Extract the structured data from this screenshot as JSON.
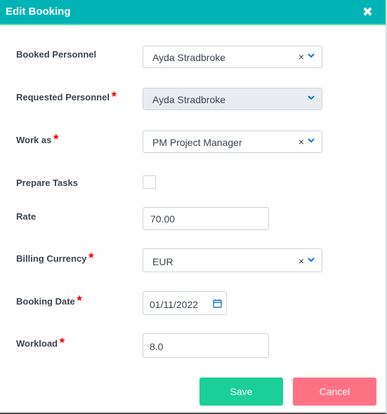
{
  "dialog": {
    "title": "Edit Booking",
    "close_icon": "close-icon"
  },
  "fields": {
    "booked_personnel": {
      "label": "Booked Personnel",
      "value": "Ayda Stradbroke",
      "required": false
    },
    "requested_personnel": {
      "label": "Requested Personnel",
      "value": "Ayda Stradbroke",
      "required": true,
      "disabled": true
    },
    "work_as": {
      "label": "Work as",
      "value": "PM Project Manager",
      "required": true
    },
    "prepare_tasks": {
      "label": "Prepare Tasks",
      "checked": false
    },
    "rate": {
      "label": "Rate",
      "value": "70.00"
    },
    "billing_currency": {
      "label": "Billing Currency",
      "value": "EUR",
      "required": true
    },
    "booking_date": {
      "label": "Booking Date",
      "value": "01/11/2022",
      "required": true
    },
    "workload": {
      "label": "Workload",
      "value": "8.0",
      "required": true
    }
  },
  "symbols": {
    "required_mark": "★",
    "clear": "×"
  },
  "buttons": {
    "save": "Save",
    "cancel": "Cancel"
  },
  "colors": {
    "header": "#00b4b6",
    "save": "#1bcf98",
    "cancel": "#ff7286",
    "required": "#ff0000",
    "icon_blue": "#1a73c9"
  }
}
